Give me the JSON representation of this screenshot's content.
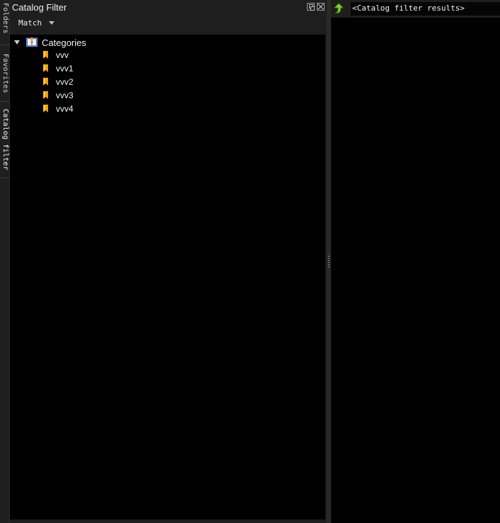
{
  "side_tabs": [
    {
      "label": "Folders"
    },
    {
      "label": "Favorites"
    },
    {
      "label": "Catalog filter",
      "active": true
    }
  ],
  "left_panel": {
    "title": "Catalog Filter",
    "match_label": "Match",
    "tree": {
      "root_label": "Categories",
      "items": [
        {
          "label": "vvv"
        },
        {
          "label": "vvv1"
        },
        {
          "label": "vvv2"
        },
        {
          "label": "vvv3"
        },
        {
          "label": "vvv4"
        }
      ]
    }
  },
  "right_panel": {
    "path_value": "<Catalog filter results>"
  },
  "colors": {
    "panel_bg": "#1e1e1e",
    "content_bg": "#000000",
    "up_arrow": "#7cd61c",
    "bookmark": "#f5a000",
    "book_blue": "#3b63c8"
  },
  "icons": {
    "float": "float-icon",
    "close": "close-icon",
    "dropdown": "chevron-down-icon",
    "expander": "expand-triangle-icon",
    "root": "book-icon",
    "item": "bookmark-icon",
    "up": "up-arrow-icon"
  }
}
